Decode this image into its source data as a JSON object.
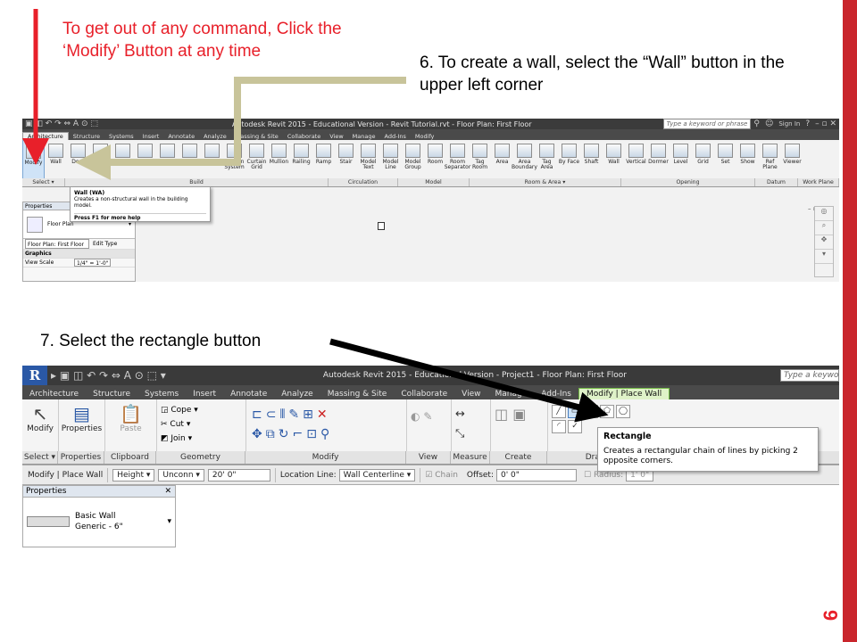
{
  "annotations": {
    "exit_hint": "To get out of any command, Click the ‘Modify’ Button at any time",
    "step6": "6. To create a wall, select the “Wall” button in the upper left corner",
    "step7": "7. Select the rectangle button"
  },
  "page_number": "6",
  "colors": {
    "annotation_red": "#e8202a",
    "side_bar": "#c9252c",
    "context_tab_green": "#72b843"
  },
  "shot1": {
    "title": "Autodesk Revit 2015 - Educational Version -  Revit Tutorial.rvt - Floor Plan: First Floor",
    "search_placeholder": "Type a keyword or phrase",
    "sign_in": "Sign In",
    "tabs": [
      "Architecture",
      "Structure",
      "Systems",
      "Insert",
      "Annotate",
      "Analyze",
      "Massing & Site",
      "Collaborate",
      "View",
      "Manage",
      "Add-Ins",
      "Modify"
    ],
    "buttons": [
      {
        "label": "Modify",
        "icon": "cursor-icon"
      },
      {
        "label": "Wall",
        "icon": "wall-icon"
      },
      {
        "label": "Door",
        "icon": "door-icon"
      },
      {
        "label": "Window",
        "icon": "window-icon"
      },
      {
        "label": "Component",
        "icon": "component-icon"
      },
      {
        "label": "Column",
        "icon": "column-icon"
      },
      {
        "label": "Roof",
        "icon": "roof-icon"
      },
      {
        "label": "Ceiling",
        "icon": "ceiling-icon"
      },
      {
        "label": "Floor",
        "icon": "floor-icon"
      },
      {
        "label": "Curtain System",
        "icon": "curtain-system-icon"
      },
      {
        "label": "Curtain Grid",
        "icon": "curtain-grid-icon"
      },
      {
        "label": "Mullion",
        "icon": "mullion-icon"
      },
      {
        "label": "Railing",
        "icon": "railing-icon"
      },
      {
        "label": "Ramp",
        "icon": "ramp-icon"
      },
      {
        "label": "Stair",
        "icon": "stair-icon"
      },
      {
        "label": "Model Text",
        "icon": "model-text-icon"
      },
      {
        "label": "Model Line",
        "icon": "model-line-icon"
      },
      {
        "label": "Model Group",
        "icon": "model-group-icon"
      },
      {
        "label": "Room",
        "icon": "room-icon"
      },
      {
        "label": "Room Separator",
        "icon": "room-separator-icon"
      },
      {
        "label": "Tag Room",
        "icon": "tag-room-icon"
      },
      {
        "label": "Area",
        "icon": "area-icon"
      },
      {
        "label": "Area Boundary",
        "icon": "area-boundary-icon"
      },
      {
        "label": "Tag Area",
        "icon": "tag-area-icon"
      },
      {
        "label": "By Face",
        "icon": "by-face-icon"
      },
      {
        "label": "Shaft",
        "icon": "shaft-icon"
      },
      {
        "label": "Wall",
        "icon": "wall-opening-icon"
      },
      {
        "label": "Vertical",
        "icon": "vertical-icon"
      },
      {
        "label": "Dormer",
        "icon": "dormer-icon"
      },
      {
        "label": "Level",
        "icon": "level-icon"
      },
      {
        "label": "Grid",
        "icon": "grid-icon"
      },
      {
        "label": "Set",
        "icon": "set-icon"
      },
      {
        "label": "Show",
        "icon": "show-icon"
      },
      {
        "label": "Ref Plane",
        "icon": "ref-plane-icon"
      },
      {
        "label": "Viewer",
        "icon": "viewer-icon"
      }
    ],
    "panels": [
      {
        "label": "Select ▾"
      },
      {
        "label": "Build"
      },
      {
        "label": "Circulation"
      },
      {
        "label": "Model"
      },
      {
        "label": "Room & Area ▾"
      },
      {
        "label": "Opening"
      },
      {
        "label": "Datum"
      },
      {
        "label": "Work Plane"
      }
    ],
    "tooltip": {
      "title": "Wall (WA)",
      "desc": "Creates a non-structural wall in the building model.",
      "help": "Press F1 for more help"
    },
    "properties": {
      "header": "Properties",
      "type": "Floor Plan",
      "selector": "Floor Plan: First Floor",
      "edit_type": "Edit Type",
      "group": "Graphics",
      "view_scale_label": "View Scale",
      "view_scale_value": "1/4\" = 1'-0\""
    }
  },
  "shot2": {
    "title": "Autodesk Revit 2015 - Educational Version -   Project1 - Floor Plan: First Floor",
    "search_placeholder": "Type a keyword",
    "tabs": [
      "Architecture",
      "Structure",
      "Systems",
      "Insert",
      "Annotate",
      "Analyze",
      "Massing & Site",
      "Collaborate",
      "View",
      "Manage",
      "Add-Ins",
      "Modify | Place Wall"
    ],
    "buttons": {
      "modify": "Modify",
      "properties": "Properties",
      "paste": "Paste",
      "cope": "Cope",
      "cut": "Cut",
      "join": "Join"
    },
    "panels": [
      "Select ▾",
      "Properties",
      "Clipboard",
      "Geometry",
      "Modify",
      "View",
      "Measure",
      "Create",
      "Draw"
    ],
    "options": {
      "context": "Modify | Place Wall",
      "height_label": "Height",
      "unconnected": "Unconn",
      "height_value": "20'  0\"",
      "location_label": "Location Line:",
      "location_value": "Wall Centerline",
      "chain": "Chain",
      "offset_label": "Offset:",
      "offset_value": "0'  0\"",
      "radius_label": "Radius:",
      "radius_value": "1'  0\""
    },
    "tooltip": {
      "title": "Rectangle",
      "desc": "Creates a rectangular chain of lines by picking 2 opposite corners."
    },
    "properties": {
      "header": "Properties",
      "close": "✕",
      "type_line1": "Basic Wall",
      "type_line2": "Generic - 6\""
    }
  }
}
